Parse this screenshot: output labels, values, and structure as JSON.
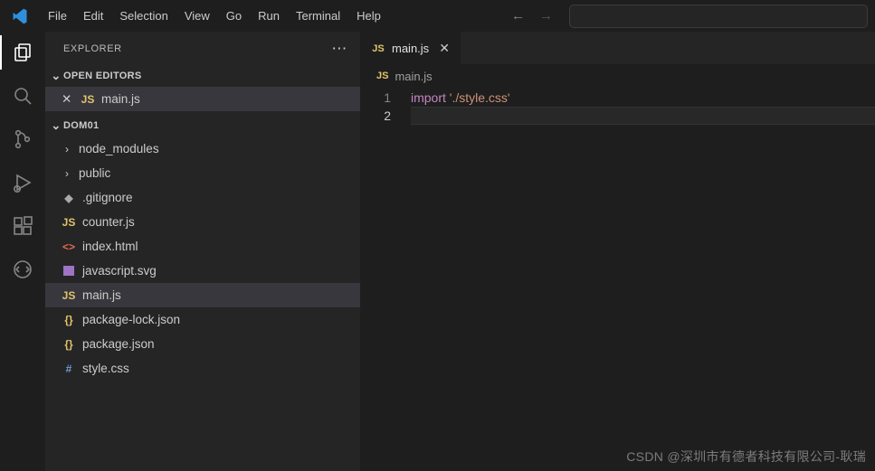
{
  "menu": [
    "File",
    "Edit",
    "Selection",
    "View",
    "Go",
    "Run",
    "Terminal",
    "Help"
  ],
  "sidebar": {
    "title": "EXPLORER",
    "sections": {
      "openEditors": {
        "label": "OPEN EDITORS",
        "items": [
          {
            "icon": "js",
            "name": "main.js",
            "active": true,
            "closeable": true
          }
        ]
      },
      "project": {
        "label": "DOM01",
        "items": [
          {
            "kind": "folder",
            "name": "node_modules"
          },
          {
            "kind": "folder",
            "name": "public"
          },
          {
            "kind": "file",
            "icon": "git",
            "name": ".gitignore"
          },
          {
            "kind": "file",
            "icon": "js",
            "name": "counter.js"
          },
          {
            "kind": "file",
            "icon": "html",
            "name": "index.html"
          },
          {
            "kind": "file",
            "icon": "svg",
            "name": "javascript.svg"
          },
          {
            "kind": "file",
            "icon": "js",
            "name": "main.js",
            "active": true
          },
          {
            "kind": "file",
            "icon": "json",
            "name": "package-lock.json"
          },
          {
            "kind": "file",
            "icon": "json",
            "name": "package.json"
          },
          {
            "kind": "file",
            "icon": "css",
            "name": "style.css"
          }
        ]
      }
    }
  },
  "tabs": [
    {
      "icon": "js",
      "name": "main.js",
      "active": true
    }
  ],
  "breadcrumb": {
    "icon": "js",
    "name": "main.js"
  },
  "code": {
    "lines": [
      {
        "n": 1,
        "tokens": [
          [
            "kw",
            "import"
          ],
          [
            "",
            " "
          ],
          [
            "str",
            "'./style.css'"
          ]
        ]
      },
      {
        "n": 2,
        "tokens": []
      }
    ],
    "currentLine": 2
  },
  "watermark": "CSDN @深圳市有德者科技有限公司-耿瑞"
}
